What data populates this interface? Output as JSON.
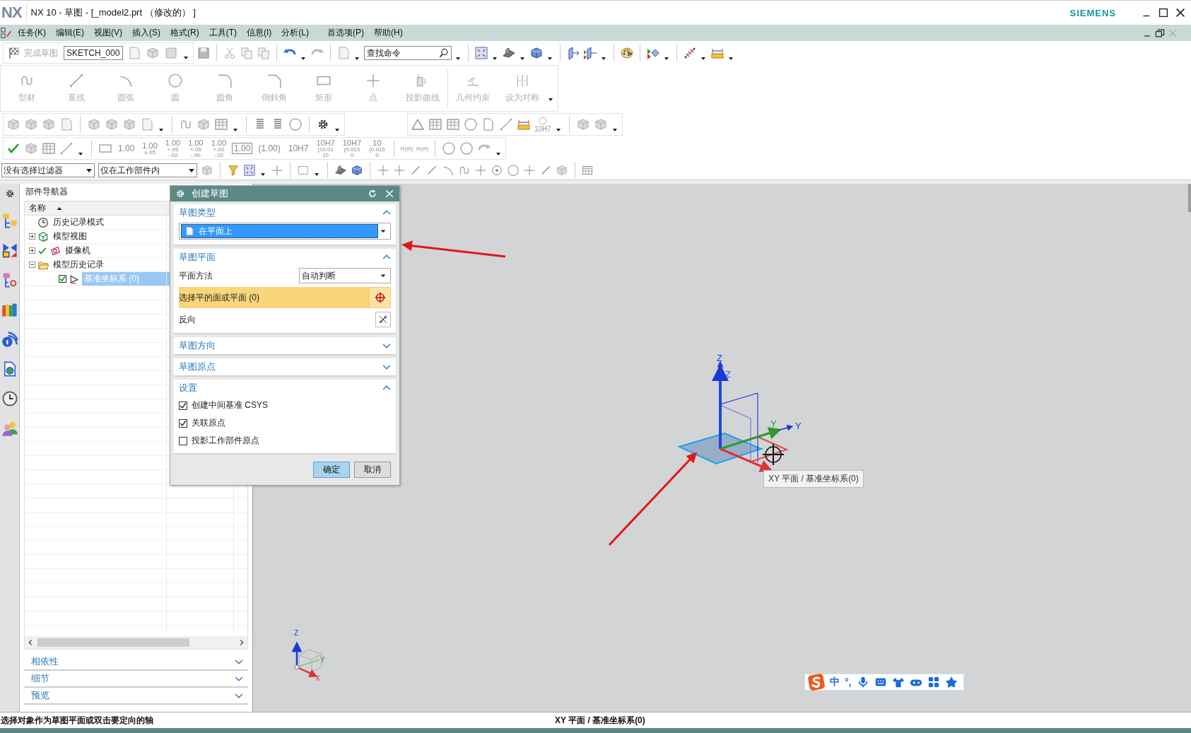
{
  "window": {
    "logo": "NX",
    "title": "NX 10 - 草图 - [_model2.prt （修改的） ]",
    "brand": "SIEMENS"
  },
  "menu": [
    {
      "label": "任务(K)"
    },
    {
      "label": "编辑(E)"
    },
    {
      "label": "视图(V)"
    },
    {
      "label": "插入(S)"
    },
    {
      "label": "格式(R)"
    },
    {
      "label": "工具(T)"
    },
    {
      "label": "信息(I)"
    },
    {
      "label": "分析(L)"
    },
    {
      "label": "首选项(P)"
    },
    {
      "label": "帮助(H)"
    }
  ],
  "quick_toolbar": {
    "finish_sketch": {
      "label": "完成草图",
      "disabled": true
    },
    "sketch_name": "SKETCH_000",
    "command_search": {
      "placeholder": "查找命令"
    }
  },
  "sketch_tools": [
    {
      "label": "型材",
      "disabled": true
    },
    {
      "label": "直线",
      "disabled": true
    },
    {
      "label": "圆弧",
      "disabled": true
    },
    {
      "label": "圆",
      "disabled": true
    },
    {
      "label": "圆角",
      "disabled": true
    },
    {
      "label": "倒斜角",
      "disabled": true
    },
    {
      "label": "矩形",
      "disabled": true
    },
    {
      "label": "点",
      "disabled": true
    },
    {
      "label": "投影曲线",
      "disabled": true
    },
    {
      "label": "几何约束",
      "disabled": true
    },
    {
      "label": "设为对称",
      "disabled": true
    }
  ],
  "inspection_toolbar": {
    "tolerance_label": "10H7"
  },
  "dimension_tools": [
    {
      "kind": "plain",
      "main": "1.00"
    },
    {
      "kind": "stacked",
      "main": "1.00",
      "lines": [
        "±.05"
      ]
    },
    {
      "kind": "stacked",
      "main": "1.00",
      "lines": [
        "+.05",
        "-.02"
      ]
    },
    {
      "kind": "stacked",
      "main": "1.00",
      "lines": [
        "+.05",
        "-.00"
      ]
    },
    {
      "kind": "stacked",
      "main": "1.00",
      "lines": [
        "+.00",
        "-.02"
      ]
    },
    {
      "kind": "boxed",
      "main": "1.00"
    },
    {
      "kind": "plain",
      "main": "(1.00)"
    },
    {
      "kind": "plain",
      "main": "10H7"
    },
    {
      "kind": "stacked",
      "main": "10H7",
      "lines": [
        "(10.01",
        "10"
      ]
    },
    {
      "kind": "stacked",
      "main": "10H7",
      "lines": [
        "(0.015",
        "0"
      ]
    },
    {
      "kind": "stacked",
      "main": "10",
      "lines": [
        "(0.015",
        "0"
      ]
    }
  ],
  "radius_tools": [
    {
      "label": "R(Ø)"
    },
    {
      "label": "R(Ø)"
    }
  ],
  "selection_bar": {
    "type_filter": "没有选择过滤器",
    "scope": "仅在工作部件内"
  },
  "navigator": {
    "title": "部件导航器",
    "column": "名称",
    "tree": [
      {
        "label": "历史记录模式",
        "selected": false
      },
      {
        "label": "模型视图",
        "expanded": false,
        "selected": false
      },
      {
        "label": "摄像机",
        "expanded": false,
        "selected": false
      },
      {
        "label": "模型历史记录",
        "expanded": true,
        "selected": false,
        "children": [
          {
            "label": "基准坐标系 (0)",
            "checked": true,
            "selected": true
          }
        ]
      }
    ],
    "panels": [
      {
        "label": "相依性",
        "expanded": false
      },
      {
        "label": "细节",
        "expanded": false
      },
      {
        "label": "预览",
        "expanded": false
      }
    ]
  },
  "dialog": {
    "title": "创建草图",
    "sections": [
      {
        "kind": "type",
        "title": "草图类型",
        "expanded": true,
        "value": "在平面上"
      },
      {
        "kind": "plane",
        "title": "草图平面",
        "expanded": true,
        "method_label": "平面方法",
        "method_value": "自动判断",
        "select_label": "选择平的面或平面 (0)",
        "reverse_label": "反向"
      },
      {
        "kind": "empty",
        "title": "草图方向",
        "expanded": false
      },
      {
        "kind": "empty",
        "title": "草图原点",
        "expanded": false
      },
      {
        "kind": "settings",
        "title": "设置",
        "expanded": true,
        "options": [
          {
            "label": "创建中间基准 CSYS",
            "checked": true
          },
          {
            "label": "关联原点",
            "checked": true
          },
          {
            "label": "投影工作部件原点",
            "checked": false
          }
        ]
      }
    ],
    "buttons": [
      {
        "label": "确定",
        "default": true
      },
      {
        "label": "取消",
        "default": false
      }
    ]
  },
  "viewport": {
    "csys_labels": {
      "z_outer": "Z",
      "z_inner": "Z",
      "y_inner": "Y",
      "y_outer": "Y"
    },
    "tooltip": "XY 平面 / 基准坐标系(0)",
    "triad_labels": {
      "z": "Z",
      "y": "Y",
      "x": "X"
    },
    "ime_bar": {
      "language": "中",
      "punctuation": "°,"
    }
  },
  "status_bar": {
    "prompt": "选择对象作为草图平面或双击要定向的轴",
    "selection": "XY 平面 / 基准坐标系(0)"
  }
}
